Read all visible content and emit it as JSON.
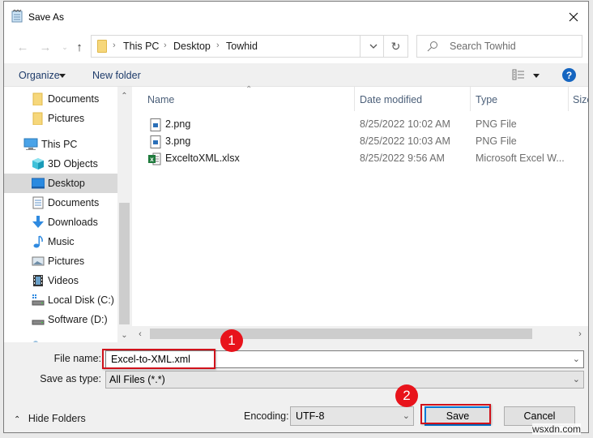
{
  "window": {
    "title": "Save As",
    "close_icon": "close-icon"
  },
  "navigation": {
    "back_icon": "arrow-left-icon",
    "forward_icon": "arrow-right-icon",
    "recent_icon": "chevron-down-icon",
    "up_icon": "arrow-up-icon",
    "breadcrumb": [
      "This PC",
      "Desktop",
      "Towhid"
    ],
    "refresh_icon": "refresh-icon",
    "search_placeholder": "Search Towhid"
  },
  "toolbar": {
    "organize_label": "Organize",
    "new_folder_label": "New folder",
    "view_icon": "details-view-icon",
    "help_label": "?"
  },
  "sidebar": {
    "items": [
      {
        "label": "Documents",
        "icon": "folder-icon",
        "level": 2
      },
      {
        "label": "Pictures",
        "icon": "folder-icon",
        "level": 2
      },
      {
        "label": "This PC",
        "icon": "computer-icon",
        "level": 1
      },
      {
        "label": "3D Objects",
        "icon": "3d-objects-icon",
        "level": 2
      },
      {
        "label": "Desktop",
        "icon": "desktop-icon",
        "level": 2,
        "selected": true
      },
      {
        "label": "Documents",
        "icon": "document-icon",
        "level": 2
      },
      {
        "label": "Downloads",
        "icon": "download-icon",
        "level": 2
      },
      {
        "label": "Music",
        "icon": "music-icon",
        "level": 2
      },
      {
        "label": "Pictures",
        "icon": "pictures-icon",
        "level": 2
      },
      {
        "label": "Videos",
        "icon": "videos-icon",
        "level": 2
      },
      {
        "label": "Local Disk (C:)",
        "icon": "drive-icon",
        "level": 2
      },
      {
        "label": "Software (D:)",
        "icon": "drive-icon",
        "level": 2
      }
    ]
  },
  "file_list": {
    "columns": [
      "Name",
      "Date modified",
      "Type",
      "Size"
    ],
    "rows": [
      {
        "name": "2.png",
        "date": "8/25/2022 10:02 AM",
        "type": "PNG File",
        "icon": "image-file-icon"
      },
      {
        "name": "3.png",
        "date": "8/25/2022 10:03 AM",
        "type": "PNG File",
        "icon": "image-file-icon"
      },
      {
        "name": "ExceltoXML.xlsx",
        "date": "8/25/2022 9:56 AM",
        "type": "Microsoft Excel W...",
        "icon": "excel-file-icon"
      }
    ]
  },
  "form": {
    "file_name_label": "File name:",
    "file_name_value": "Excel-to-XML.xml",
    "save_as_type_label": "Save as type:",
    "save_as_type_value": "All Files  (*.*)",
    "encoding_label": "Encoding:",
    "encoding_value": "UTF-8"
  },
  "footer": {
    "hide_folders_label": "Hide Folders",
    "save_label": "Save",
    "cancel_label": "Cancel"
  },
  "annotations": {
    "step1": "1",
    "step2": "2",
    "highlight_color": "#d0121b",
    "badge_color": "#e8131b"
  },
  "watermark": "wsxdn.com"
}
